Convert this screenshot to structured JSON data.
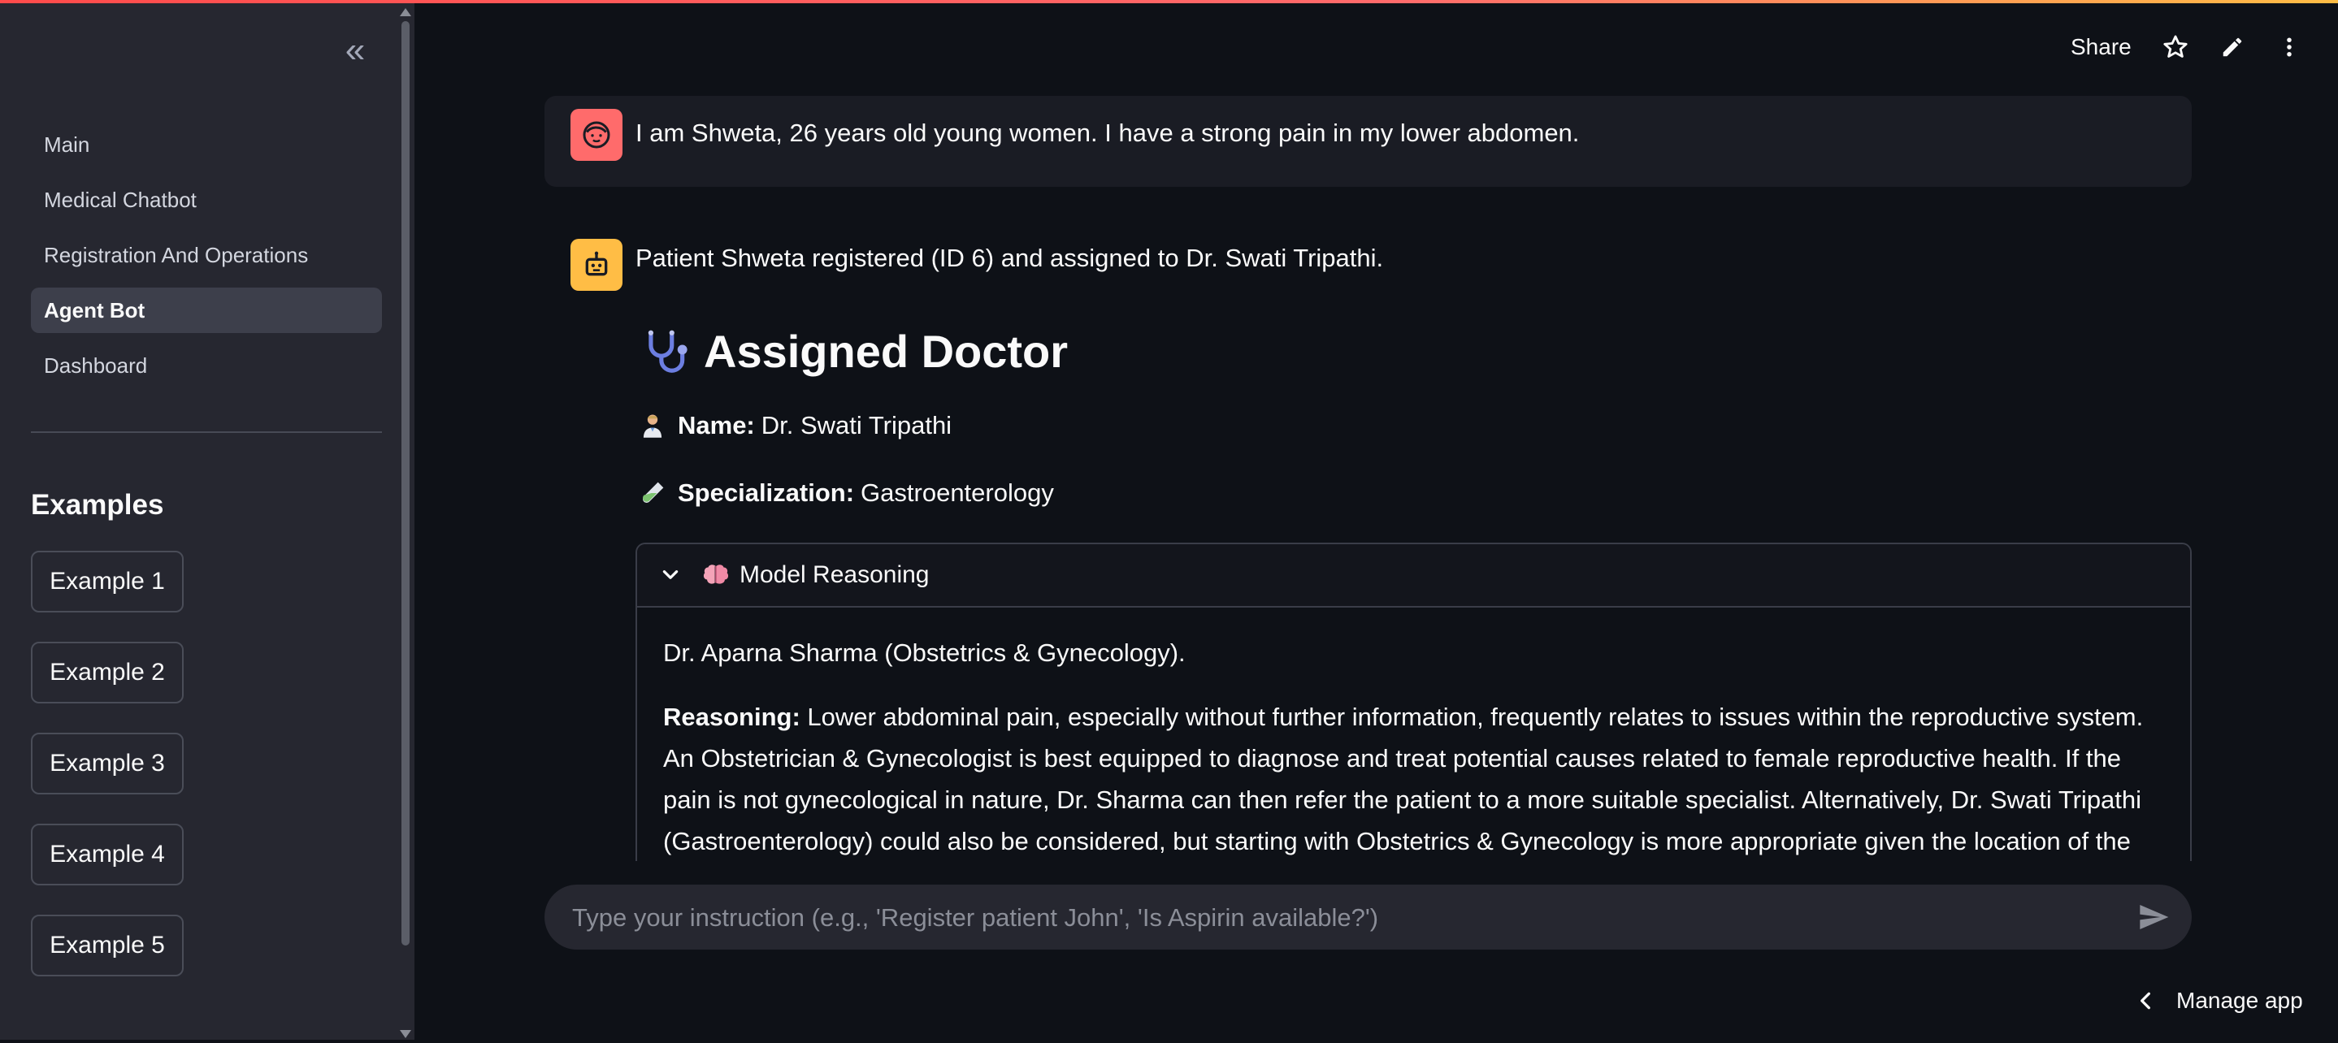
{
  "colors": {
    "background": "#0e1117",
    "sidebar": "#262730",
    "user_avatar": "#ff6b6b",
    "bot_avatar": "#ffbd45",
    "accent_gradient": [
      "#ff4b4b",
      "#ffbd45"
    ]
  },
  "sidebar": {
    "collapse_icon": "double-chevron-left-icon",
    "nav_items": [
      {
        "label": "Main",
        "active": false
      },
      {
        "label": "Medical Chatbot",
        "active": false
      },
      {
        "label": "Registration And Operations",
        "active": false
      },
      {
        "label": "Agent Bot",
        "active": true
      },
      {
        "label": "Dashboard",
        "active": false
      }
    ],
    "examples_title": "Examples",
    "examples": [
      "Example 1",
      "Example 2",
      "Example 3",
      "Example 4",
      "Example 5"
    ]
  },
  "header": {
    "share_label": "Share",
    "icons": [
      "star-icon",
      "pencil-icon",
      "more-vertical-icon"
    ]
  },
  "chat": {
    "user_message": "I am Shweta, 26 years old young women. I have a strong pain in my lower abdomen.",
    "bot_message": "Patient Shweta registered (ID 6) and assigned to Dr. Swati Tripathi.",
    "assigned_title": "Assigned Doctor",
    "name_label": "Name:",
    "name_value": "Dr. Swati Tripathi",
    "specialization_label": "Specialization:",
    "specialization_value": "Gastroenterology",
    "expander": {
      "title": "Model Reasoning",
      "expanded": true,
      "first_line": "Dr. Aparna Sharma (Obstetrics & Gynecology).",
      "reasoning_label": "Reasoning:",
      "reasoning_text": "Lower abdominal pain, especially without further information, frequently relates to issues within the reproductive system. An Obstetrician & Gynecologist is best equipped to diagnose and treat potential causes related to female reproductive health. If the pain is not gynecological in nature, Dr. Sharma can then refer the patient to a more suitable specialist. Alternatively, Dr. Swati Tripathi (Gastroenterology) could also be considered, but starting with Obstetrics & Gynecology is more appropriate given the location of the pain."
    }
  },
  "input": {
    "placeholder": "Type your instruction (e.g., 'Register patient John', 'Is Aspirin available?')",
    "value": ""
  },
  "footer": {
    "manage_app_label": "Manage app"
  }
}
